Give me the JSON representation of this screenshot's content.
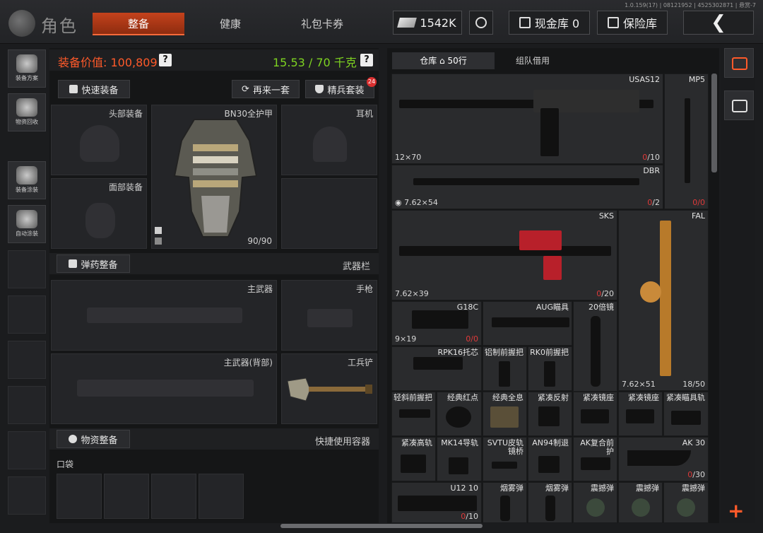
{
  "version": "1.0.159(17) | 08121952 | 4525302871 | 悬赏-7",
  "header": {
    "title": "角色",
    "tabs": [
      {
        "label": "整备",
        "active": true
      },
      {
        "label": "健康",
        "active": false
      },
      {
        "label": "礼包卡券",
        "active": false
      }
    ],
    "money": "1542K",
    "cash_vault": "现金库 0",
    "insurance": "保险库"
  },
  "sidebar": [
    {
      "label": "装备方案",
      "icon": "helmet-icon"
    },
    {
      "label": "物资回收",
      "icon": "recycle-icon"
    },
    {
      "label": "装备涂装",
      "icon": "paint-mask-icon"
    },
    {
      "label": "自动涂装",
      "icon": "brush-icon"
    }
  ],
  "equip": {
    "value_label": "装备价值: 100,809",
    "weight_label": "15.53 / 70 千克",
    "help": "?",
    "quick_equip": "快速装备",
    "again": "再来一套",
    "elite": "精兵套装",
    "elite_badge": "24",
    "slots": {
      "head": "头部装备",
      "face": "面部装备",
      "armor": "BN30全护甲",
      "armor_count": "90/90",
      "ear": "耳机"
    },
    "ammo_equip": "弹药整备",
    "weapon_bar": "武器栏",
    "primary": "主武器",
    "pistol": "手枪",
    "primary_back": "主武器(背部)",
    "shovel": "工兵铲",
    "supply_equip": "物资整备",
    "quick_container": "快捷使用容器",
    "pocket": "口袋"
  },
  "storage": {
    "tab_warehouse": "仓库",
    "tab_rows": "50行",
    "tab_team": "组队借用",
    "items": [
      {
        "name": "USAS12",
        "ammo": "12×70",
        "cap_num": "0",
        "cap_den": "/10"
      },
      {
        "name": "MP5",
        "ammo": "",
        "cap_num": "0",
        "cap_den": "/0"
      },
      {
        "name": "DBR",
        "ammo": "7.62×54",
        "cap_num": "0",
        "cap_den": "/2"
      },
      {
        "name": "SKS",
        "ammo": "7.62×39",
        "cap_num": "0",
        "cap_den": "/20"
      },
      {
        "name": "FAL",
        "ammo": "7.62×51",
        "cap_num": "",
        "cap_den": "18/50"
      },
      {
        "name": "G18C",
        "ammo": "9×19",
        "cap_num": "0",
        "cap_den": "/0"
      },
      {
        "name": "AUG瞄具",
        "ammo": "",
        "cap_num": "",
        "cap_den": ""
      },
      {
        "name": "20倍镜",
        "ammo": "",
        "cap_num": "",
        "cap_den": ""
      },
      {
        "name": "RPK16托芯",
        "ammo": "",
        "cap_num": "",
        "cap_den": ""
      },
      {
        "name": "铝制前握把",
        "ammo": "",
        "cap_num": "",
        "cap_den": ""
      },
      {
        "name": "RK0前握把",
        "ammo": "",
        "cap_num": "",
        "cap_den": ""
      },
      {
        "name": "轻斜前握把",
        "ammo": "",
        "cap_num": "",
        "cap_den": ""
      },
      {
        "name": "经典红点",
        "ammo": "",
        "cap_num": "",
        "cap_den": ""
      },
      {
        "name": "经典全息",
        "ammo": "",
        "cap_num": "",
        "cap_den": ""
      },
      {
        "name": "紧凑反射",
        "ammo": "",
        "cap_num": "",
        "cap_den": ""
      },
      {
        "name": "紧凑镜座",
        "ammo": "",
        "cap_num": "",
        "cap_den": ""
      },
      {
        "name": "紧凑镜座",
        "ammo": "",
        "cap_num": "",
        "cap_den": ""
      },
      {
        "name": "紧凑瞄具轨",
        "ammo": "",
        "cap_num": "",
        "cap_den": ""
      },
      {
        "name": "紧凑高轨",
        "ammo": "",
        "cap_num": "",
        "cap_den": ""
      },
      {
        "name": "MK14导轨",
        "ammo": "",
        "cap_num": "",
        "cap_den": ""
      },
      {
        "name": "SVTU皮轨镜桥",
        "ammo": "",
        "cap_num": "",
        "cap_den": ""
      },
      {
        "name": "AN94制退",
        "ammo": "",
        "cap_num": "",
        "cap_den": ""
      },
      {
        "name": "AK复合前护",
        "ammo": "",
        "cap_num": "",
        "cap_den": ""
      },
      {
        "name": "AK 30",
        "ammo": "",
        "cap_num": "0",
        "cap_den": "/30"
      },
      {
        "name": "U12 10",
        "ammo": "",
        "cap_num": "0",
        "cap_den": "/10"
      },
      {
        "name": "烟雾弹",
        "ammo": "",
        "cap_num": "",
        "cap_den": ""
      },
      {
        "name": "烟雾弹",
        "ammo": "",
        "cap_num": "",
        "cap_den": ""
      },
      {
        "name": "震撼弹",
        "ammo": "",
        "cap_num": "",
        "cap_den": ""
      },
      {
        "name": "震撼弹",
        "ammo": "",
        "cap_num": "",
        "cap_den": ""
      },
      {
        "name": "震撼弹",
        "ammo": "",
        "cap_num": "",
        "cap_den": ""
      }
    ]
  },
  "plus": "+",
  "colors": {
    "accent": "#c4421c",
    "value_red": "#ff5a2a",
    "weight_green": "#7ed321",
    "cap_red": "#e03a3a"
  }
}
